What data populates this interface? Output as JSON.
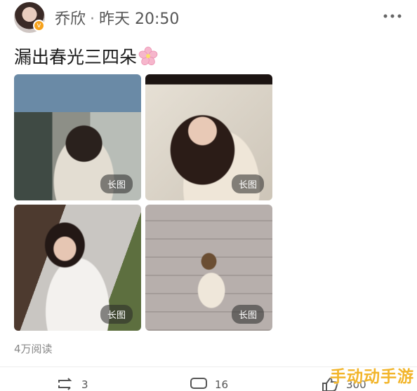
{
  "header": {
    "username": "乔欣",
    "separator": "·",
    "timestamp": "昨天 20:50",
    "avatar_badge_icon": "verified-v-icon",
    "more_icon": "more-dots-icon"
  },
  "post": {
    "text": "漏出春光三四朵",
    "emoji_icon": "cherry-blossom-icon"
  },
  "photos": [
    {
      "label": "长图"
    },
    {
      "label": "长图"
    },
    {
      "label": "长图"
    },
    {
      "label": "长图"
    }
  ],
  "stats": {
    "reads": "4万阅读"
  },
  "actions": {
    "repost_count": "3",
    "comment_count": "16",
    "like_count": "300"
  },
  "watermark": "手动动手游"
}
